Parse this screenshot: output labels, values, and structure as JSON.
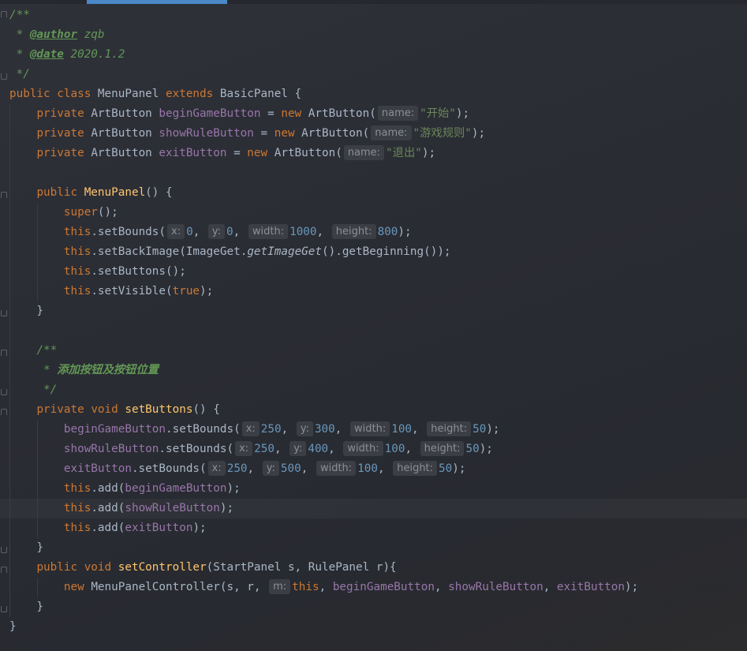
{
  "editor": {
    "comment": {
      "open": "/**",
      "author_prefix": " * ",
      "author_tag": "@author",
      "author_value": " zqb",
      "date_prefix": " * ",
      "date_tag": "@date",
      "date_value": " 2020.1.2",
      "close": " */"
    },
    "class_decl": {
      "public": "public",
      "class": "class",
      "name": "MenuPanel",
      "extends": "extends",
      "parent": "BasicPanel {"
    },
    "fields": [
      {
        "name": "beginGameButton",
        "hint": "name:",
        "value": "\"开始\""
      },
      {
        "name": "showRuleButton",
        "hint": "name:",
        "value": "\"游戏规则\""
      },
      {
        "name": "exitButton",
        "hint": "name:",
        "value": "\"退出\""
      }
    ],
    "tokens": {
      "private": "private",
      "type": "ArtButton",
      "new": "new",
      "this": "this",
      "public": "public",
      "void": "void",
      "super": "super",
      "true": "true"
    },
    "constructor": {
      "name": "MenuPanel",
      "set_bounds": {
        "x": "0",
        "y": "0",
        "width": "1000",
        "height": "800"
      },
      "back_image_call": "ImageGet",
      "back_image_method": "getImageGet",
      "back_image_tail": "().getBeginning());"
    },
    "hints": {
      "x": "x:",
      "y": "y:",
      "width": "width:",
      "height": "height:",
      "m": "m:"
    },
    "set_buttons_comment": {
      "open": "/**",
      "text": "添加按钮及按钮位置",
      "prefix": " * ",
      "close": " */"
    },
    "set_buttons": {
      "name": "setButtons",
      "rows": [
        {
          "field": "beginGameButton",
          "x": "250",
          "y": "300",
          "width": "100",
          "height": "50"
        },
        {
          "field": "showRuleButton",
          "x": "250",
          "y": "400",
          "width": "100",
          "height": "50"
        },
        {
          "field": "exitButton",
          "x": "250",
          "y": "500",
          "width": "100",
          "height": "50"
        }
      ]
    },
    "set_controller": {
      "name": "setController",
      "params": "(StartPanel s, RulePanel r){",
      "controller": "MenuPanelController",
      "args_start": "(s, r, "
    }
  }
}
